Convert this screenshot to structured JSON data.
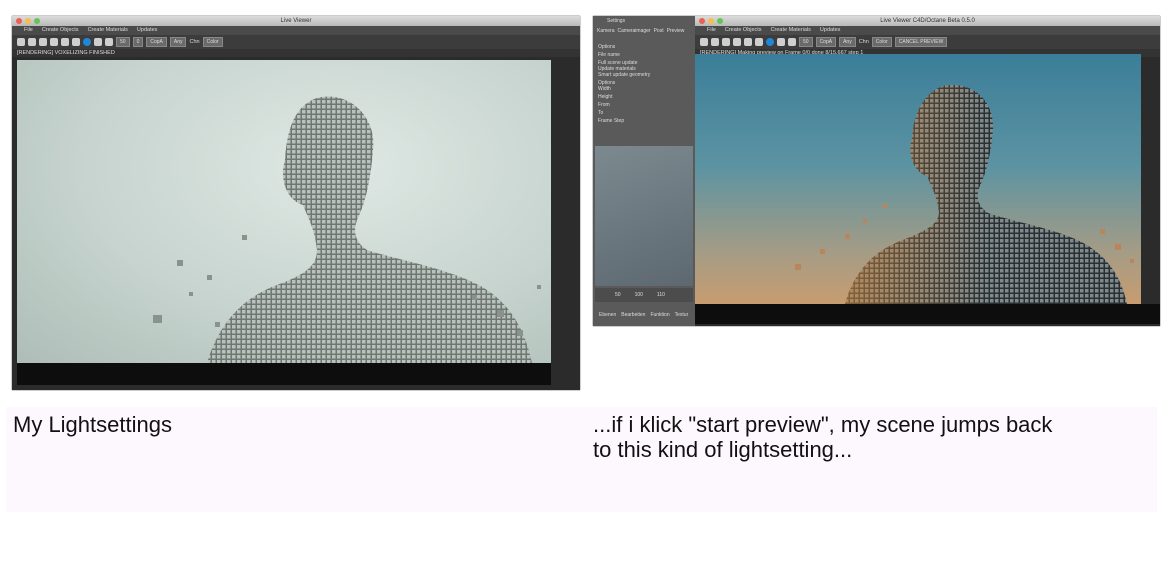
{
  "left_screenshot": {
    "window_title": "Live Viewer",
    "menu": [
      "File",
      "Create Objects",
      "Create Materials",
      "Updates"
    ],
    "toolbar_fields": [
      "50",
      "0",
      "CopA",
      "Any",
      "Chn",
      "Color"
    ],
    "status_text": "[RENDERING] VOXELIZING FINISHED"
  },
  "right_screenshot": {
    "window_title": "Live Viewer        C4D/Octane Beta 0.5.0",
    "menu": [
      "File",
      "Create Objects",
      "Create Materials",
      "Updates"
    ],
    "toolbar_fields": [
      "50",
      "CopA",
      "Any",
      "Chn",
      "Color",
      "CANCEL PREVIEW"
    ],
    "status_text": "[RENDERING] Making preview on Frame 0/0 done 8/15.667 step 1",
    "side_panel": {
      "title": "Settings",
      "tabs": [
        "Kamera",
        "Cameraimager",
        "Post",
        "Preview",
        "Setting"
      ],
      "rows": [
        "Options",
        "File name",
        "Full scene update",
        "Update materials",
        "Smart update geometry",
        "Options",
        "Width",
        "Height",
        "From",
        "To",
        "Frame Step"
      ],
      "bottom_tabs": [
        "Ebenen",
        "Bearbeiten",
        "Funktion",
        "Textur"
      ],
      "timeline_ticks": [
        "50",
        "100",
        "110"
      ]
    }
  },
  "captions": {
    "left": "My Lightsettings",
    "right_line1": "...if i klick \"start preview\", my scene jumps back",
    "right_line2": "to this kind of lightsetting..."
  },
  "colors": {
    "close_dot": "#ee5e55",
    "min_dot": "#f5be4f",
    "max_dot": "#62c655",
    "caption_bg": "#fdf8fd"
  }
}
